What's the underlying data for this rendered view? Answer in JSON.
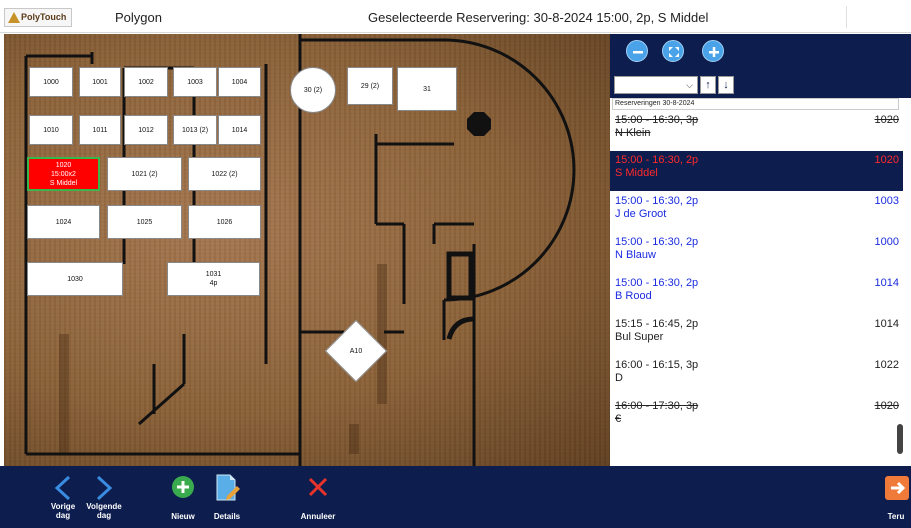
{
  "header": {
    "logo_text": "PolyTouch",
    "app_name": "Polygon",
    "title": "Geselecteerde Reservering: 30-8-2024 15:00, 2p, S Middel"
  },
  "floor": {
    "tables": [
      {
        "id": "t1000",
        "label": "1000"
      },
      {
        "id": "t1001",
        "label": "1001"
      },
      {
        "id": "t1002",
        "label": "1002"
      },
      {
        "id": "t1003",
        "label": "1003"
      },
      {
        "id": "t1004",
        "label": "1004"
      },
      {
        "id": "t1010",
        "label": "1010"
      },
      {
        "id": "t1011",
        "label": "1011"
      },
      {
        "id": "t1012",
        "label": "1012"
      },
      {
        "id": "t1013",
        "label": "1013 (2)"
      },
      {
        "id": "t1014",
        "label": "1014"
      },
      {
        "id": "t1020",
        "label": "1020\n15:00x2\nS Middel",
        "selected": true
      },
      {
        "id": "t1021",
        "label": "1021 (2)"
      },
      {
        "id": "t1022",
        "label": "1022 (2)"
      },
      {
        "id": "t1024",
        "label": "1024"
      },
      {
        "id": "t1025",
        "label": "1025"
      },
      {
        "id": "t1026",
        "label": "1026"
      },
      {
        "id": "t1030",
        "label": "1030"
      },
      {
        "id": "t1031",
        "label": "1031\n4p"
      },
      {
        "id": "t30",
        "label": "30 (2)"
      },
      {
        "id": "t29",
        "label": "29 (2)"
      },
      {
        "id": "t31",
        "label": "31"
      },
      {
        "id": "tA10",
        "label": "A10"
      }
    ]
  },
  "panel": {
    "zoom_out_icon": "zoom-out-icon",
    "zoom_fit_icon": "zoom-fit-icon",
    "zoom_in_icon": "zoom-in-icon",
    "dropdown_value": "",
    "sort_up": "↑",
    "sort_down": "↓",
    "list_header": "Reserveringen 30-8-2024",
    "reservations": [
      {
        "time": "15:00 - 16:30, 3p",
        "name": "N Klein",
        "table": "1020",
        "state": "cancelled"
      },
      {
        "time": "15:00 - 16:30, 2p",
        "name": "S Middel",
        "table": "1020",
        "state": "selected"
      },
      {
        "time": "15:00 - 16:30, 2p",
        "name": "J de Groot",
        "table": "1003",
        "state": "blue"
      },
      {
        "time": "15:00 - 16:30, 2p",
        "name": "N Blauw",
        "table": "1000",
        "state": "blue"
      },
      {
        "time": "15:00 - 16:30, 2p",
        "name": "B Rood",
        "table": "1014",
        "state": "blue"
      },
      {
        "time": "15:15 - 16:45, 2p",
        "name": "Bul Super",
        "table": "1014",
        "state": "plain"
      },
      {
        "time": "16:00 - 16:15, 3p",
        "name": "D",
        "table": "1022",
        "state": "plain"
      },
      {
        "time": "16:00 - 17:30, 3p",
        "name": "€",
        "table": "1020",
        "state": "cancelled"
      }
    ]
  },
  "toolbar": {
    "prev_label": "Vorige\ndag",
    "next_label": "Volgende\ndag",
    "new_label": "Nieuw",
    "details_label": "Details",
    "cancel_label": "Annuleer",
    "back_label": "Teru"
  },
  "colors": {
    "navy": "#0d1d4d",
    "selected_table": "#ff0000",
    "reservation_blue": "#1a2bdf",
    "selected_text": "#ff2a2a",
    "new_green": "#3aaa4e",
    "cancel_red": "#e8332a",
    "back_orange": "#f07a3a"
  }
}
